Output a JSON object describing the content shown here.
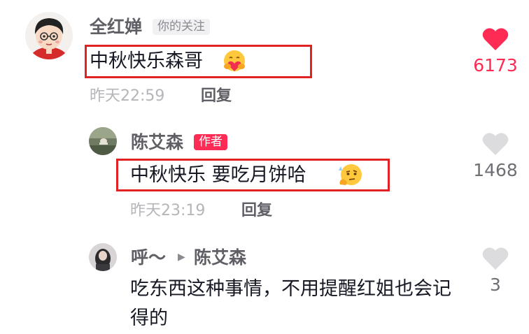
{
  "comments": [
    {
      "username": "全红婵",
      "tag": "你的关注",
      "text": "中秋快乐森哥",
      "emoji_icon": "hugging-face-heart-icon",
      "time": "昨天22:59",
      "reply_label": "回复",
      "likes": "6173",
      "liked": true
    },
    {
      "username": "陈艾森",
      "tag": "作者",
      "text": "中秋快乐 要吃月饼哈",
      "emoji_icon": "thinking-face-icon",
      "time": "昨天23:19",
      "reply_label": "回复",
      "likes": "1468",
      "liked": false
    },
    {
      "username": "呼～",
      "reply_to": "陈艾森",
      "text": "吃东西这种事情，不用提醒红姐也会记得的",
      "likes": "3",
      "liked": false
    }
  ],
  "colors": {
    "like_active": "#fe2c55",
    "like_inactive": "#dcdcdf",
    "author_tag": "#fe2c55",
    "highlight": "#e02222"
  }
}
